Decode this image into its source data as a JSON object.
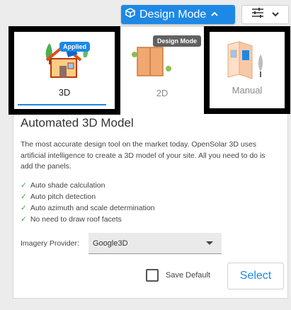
{
  "toolbar": {
    "mode_label": "Design Mode",
    "mode_icon": "cube-icon",
    "mode_chevron": "chevron-up-icon",
    "filter_icon": "tune-sliders-icon",
    "filter_chevron": "chevron-down-icon"
  },
  "options": [
    {
      "label": "3D",
      "icon": "house-3d-icon",
      "selected": true
    },
    {
      "label": "2D",
      "icon": "floorplan-2d-icon",
      "selected": false
    },
    {
      "label": "Manual",
      "icon": "manual-map-icon",
      "selected": false
    }
  ],
  "badge": {
    "applied": "Applied"
  },
  "tooltip": {
    "text": "Design Mode"
  },
  "details": {
    "heading": "Automated 3D Model",
    "description": "The most accurate design tool on the market today. OpenSolar 3D uses artificial intelligence to create a 3D model of your site. All you need to do is add the panels.",
    "features": [
      "Auto shade calculation",
      "Auto pitch detection",
      "Auto azimuth and scale determination",
      "No need to draw roof facets"
    ],
    "check_glyph": "✓"
  },
  "imagery": {
    "label": "Imagery Provider:",
    "value": "Google3D"
  },
  "footer": {
    "save_default": "Save Default",
    "save_default_checked": false,
    "select_label": "Select"
  },
  "colors": {
    "accent": "#1e88e5",
    "check": "#43a047",
    "highlight_border": "#000000"
  }
}
